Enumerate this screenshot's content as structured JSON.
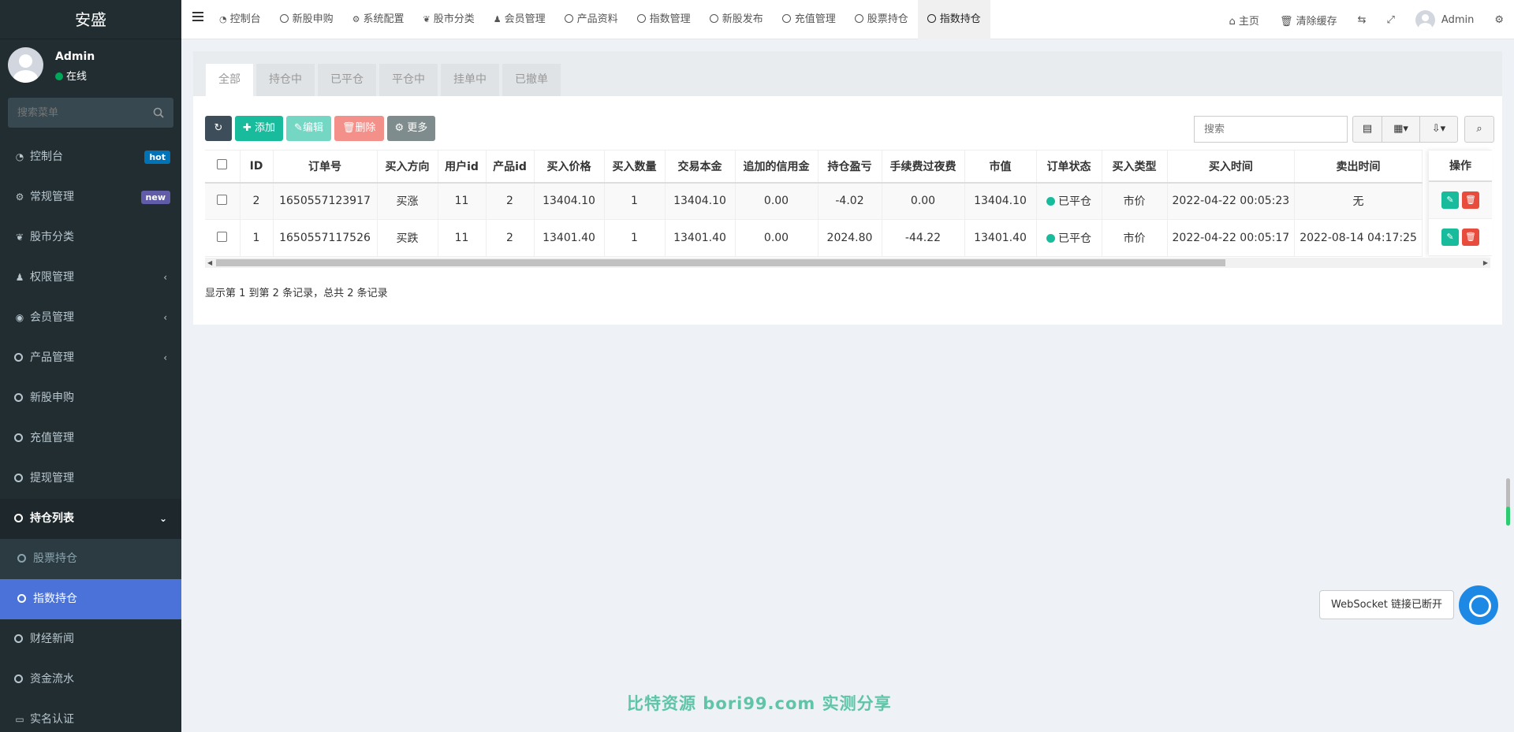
{
  "brand": "安盛",
  "user": {
    "name": "Admin",
    "status": "在线"
  },
  "sidebar_search": {
    "placeholder": "搜索菜单"
  },
  "menu": [
    {
      "label": "控制台",
      "badge": "hot",
      "badge_color": "#0073b7"
    },
    {
      "label": "常规管理",
      "badge": "new",
      "badge_color": "#605ca8"
    },
    {
      "label": "股市分类"
    },
    {
      "label": "权限管理"
    },
    {
      "label": "会员管理"
    },
    {
      "label": "产品管理"
    },
    {
      "label": "新股申购"
    },
    {
      "label": "充值管理"
    },
    {
      "label": "提现管理"
    },
    {
      "label": "持仓列表"
    },
    {
      "label": "股票持仓"
    },
    {
      "label": "指数持仓"
    },
    {
      "label": "财经新闻"
    },
    {
      "label": "资金流水"
    },
    {
      "label": "实名认证"
    }
  ],
  "top_tabs": [
    "控制台",
    "新股申购",
    "系统配置",
    "股市分类",
    "会员管理",
    "产品资料",
    "指数管理",
    "新股发布",
    "充值管理",
    "股票持仓",
    "指数持仓"
  ],
  "top_right": {
    "home": "主页",
    "clear_cache": "清除缓存",
    "user": "Admin"
  },
  "panel_tabs": [
    "全部",
    "持仓中",
    "已平仓",
    "平仓中",
    "挂单中",
    "已撤单"
  ],
  "toolbar": {
    "add": "添加",
    "edit": "编辑",
    "delete": "删除",
    "more": "更多"
  },
  "table_search": {
    "placeholder": "搜索"
  },
  "columns": [
    "ID",
    "订单号",
    "买入方向",
    "用户id",
    "产品id",
    "买入价格",
    "买入数量",
    "交易本金",
    "追加的信用金",
    "持仓盈亏",
    "手续费过夜费",
    "市值",
    "订单状态",
    "买入类型",
    "买入时间",
    "卖出时间"
  ],
  "op_header": "操作",
  "rows": [
    [
      "2",
      "1650557123917",
      "买涨",
      "11",
      "2",
      "13404.10",
      "1",
      "13404.10",
      "0.00",
      "-4.02",
      "0.00",
      "13404.10",
      "已平仓",
      "市价",
      "2022-04-22 00:05:23",
      "无"
    ],
    [
      "1",
      "1650557117526",
      "买跌",
      "11",
      "2",
      "13401.40",
      "1",
      "13401.40",
      "0.00",
      "2024.80",
      "-44.22",
      "13401.40",
      "已平仓",
      "市价",
      "2022-04-22 00:05:17",
      "2022-08-14 04:17:25"
    ]
  ],
  "pager": "显示第 1 到第 2 条记录，总共 2 条记录",
  "ws_tip": "WebSocket 链接已断开",
  "watermark": "比特资源 bori99.com 实测分享",
  "colors": {
    "sidebar": "#222d32",
    "active": "#4b72d8",
    "green": "#18bc9c",
    "red": "#e74c3c"
  }
}
